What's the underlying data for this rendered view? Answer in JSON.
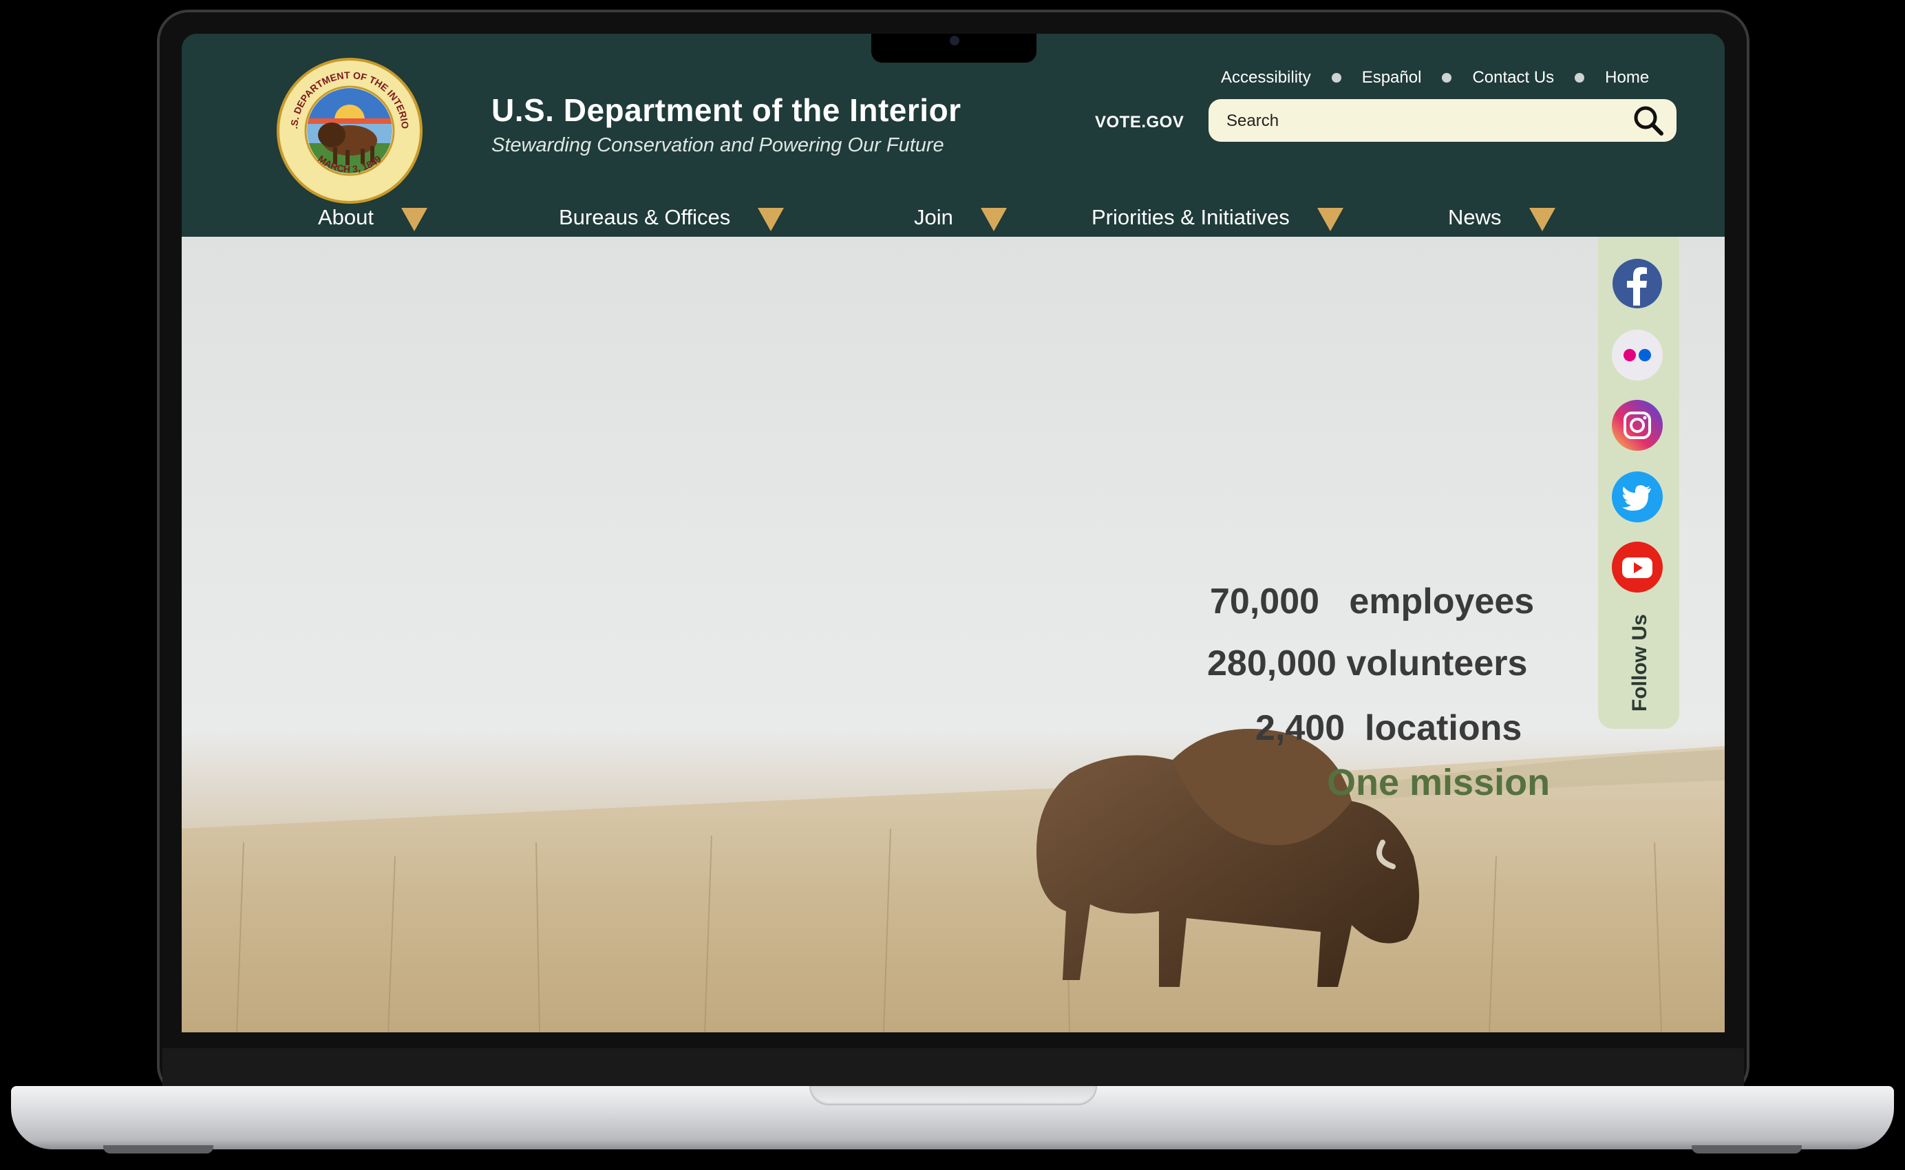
{
  "header": {
    "title": "U.S. Department of the Interior",
    "tagline": "Stewarding Conservation and Powering Our Future",
    "seal": {
      "top_text": "U.S. DEPARTMENT OF THE INTERIOR",
      "bottom_text": "MARCH 3, 1849"
    },
    "utility_links": [
      "Accessibility",
      "Español",
      "Contact Us",
      "Home"
    ],
    "vote_link": "VOTE.GOV",
    "search": {
      "placeholder": "Search",
      "icon": "search-icon"
    }
  },
  "nav": {
    "items": [
      {
        "label": "About"
      },
      {
        "label": "Bureaus & Offices"
      },
      {
        "label": "Join"
      },
      {
        "label": "Priorities & Initiatives"
      },
      {
        "label": "News"
      }
    ],
    "caret_color": "#d6a95a"
  },
  "hero": {
    "stats": [
      {
        "number": "70,000",
        "label": "employees"
      },
      {
        "number": "280,000",
        "label": "volunteers"
      },
      {
        "number": "2,400",
        "label": "locations"
      }
    ],
    "mission": "One mission",
    "image": "bison grazing on prairie"
  },
  "social": {
    "label": "Follow Us",
    "icons": [
      "facebook-icon",
      "flickr-icon",
      "instagram-icon",
      "twitter-icon",
      "youtube-icon"
    ]
  },
  "colors": {
    "header_bg": "#1f3b3a",
    "search_bg": "#f7f4dc",
    "mission": "#55713f",
    "social_panel": "#d6e1c4"
  }
}
